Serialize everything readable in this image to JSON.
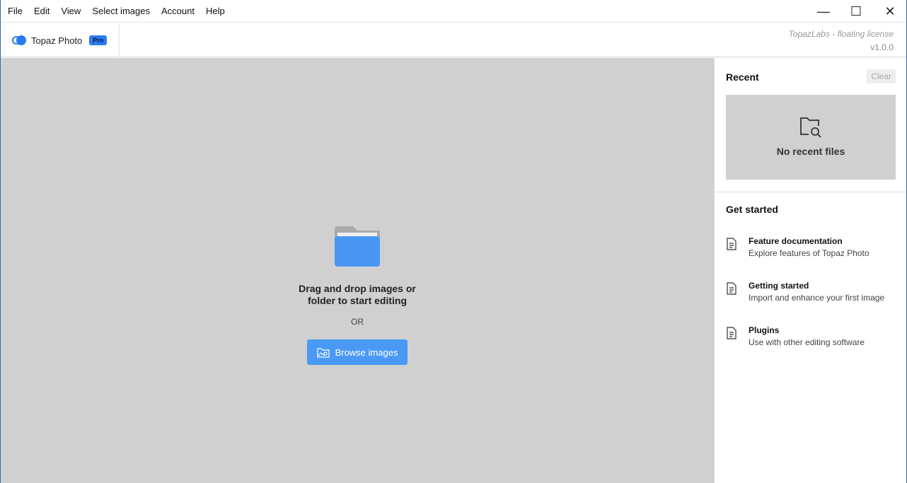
{
  "menubar": {
    "items": [
      "File",
      "Edit",
      "View",
      "Select images",
      "Account",
      "Help"
    ]
  },
  "window": {
    "minimize": "—",
    "maximize": "☐",
    "close": "✕"
  },
  "header": {
    "brand": "Topaz Photo",
    "badge": "Pro",
    "license": "TopazLabs - floating license",
    "version": "v1.0.0"
  },
  "main": {
    "drop_line1": "Drag and drop images or",
    "drop_line2": "folder to start editing",
    "or": "OR",
    "browse": "Browse images"
  },
  "sidebar": {
    "recent_title": "Recent",
    "clear": "Clear",
    "no_recent": "No recent files",
    "get_started": "Get started",
    "items": [
      {
        "title": "Feature documentation",
        "desc": "Explore features of Topaz Photo"
      },
      {
        "title": "Getting started",
        "desc": "Import and enhance your first image"
      },
      {
        "title": "Plugins",
        "desc": "Use with other editing software"
      }
    ]
  },
  "colors": {
    "accent": "#4a9af5",
    "canvas": "#d0d0d0"
  }
}
